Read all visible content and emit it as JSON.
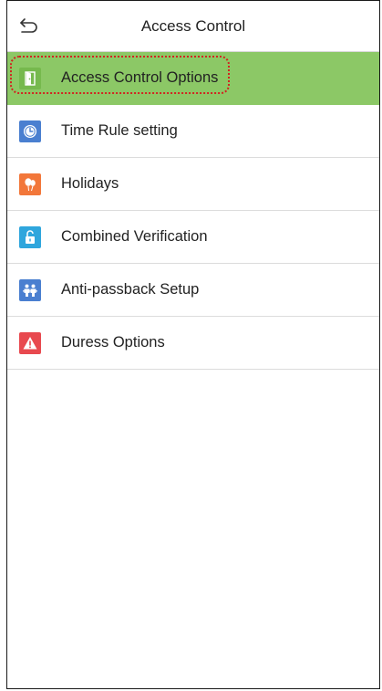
{
  "header": {
    "title": "Access Control",
    "back_icon": "back-arrow-icon"
  },
  "menu": {
    "items": [
      {
        "label": "Access Control Options",
        "icon": "door-icon",
        "icon_color": "#76b94d",
        "selected": true
      },
      {
        "label": "Time Rule setting",
        "icon": "clock-icon",
        "icon_color": "#4a7fd0",
        "selected": false
      },
      {
        "label": "Holidays",
        "icon": "balloons-icon",
        "icon_color": "#f2773a",
        "selected": false
      },
      {
        "label": "Combined Verification",
        "icon": "unlock-icon",
        "icon_color": "#2fa6dd",
        "selected": false
      },
      {
        "label": "Anti-passback Setup",
        "icon": "people-icon",
        "icon_color": "#4a7fd0",
        "selected": false
      },
      {
        "label": "Duress Options",
        "icon": "warning-icon",
        "icon_color": "#e8494f",
        "selected": false
      }
    ]
  },
  "colors": {
    "selected_background": "#8cc866",
    "highlight_ring": "#d2231f"
  }
}
